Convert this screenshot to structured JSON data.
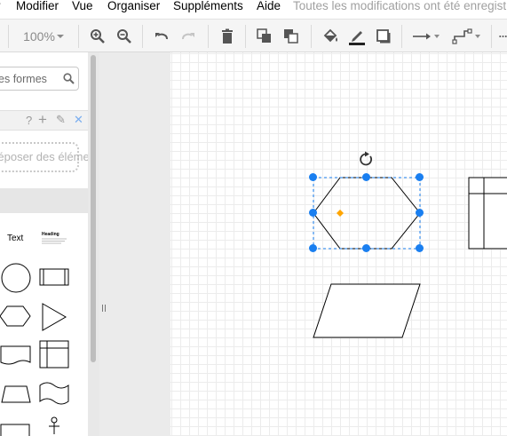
{
  "menu": {
    "items": [
      "Modifier",
      "Vue",
      "Organiser",
      "Suppléments",
      "Aide"
    ],
    "status": "Toutes les modifications ont été enregistrées"
  },
  "toolbar": {
    "zoom": "100%",
    "icons": [
      "zoom-in-icon",
      "zoom-out-icon",
      "undo-icon",
      "redo-icon",
      "delete-icon",
      "to-front-icon",
      "to-back-icon",
      "fill-color-icon",
      "line-color-icon",
      "shadow-icon",
      "connection-icon",
      "waypoints-icon",
      "more-icon"
    ]
  },
  "sidebar": {
    "search_placeholder": "Rechercher des formes",
    "scratchpad_actions": [
      "?",
      "+",
      "✎",
      "✕"
    ],
    "scratchpad_drop": "Déposer des éléments ici",
    "shapes": {
      "text_label": "Text",
      "heading_label": "Heading"
    }
  },
  "colors": {
    "selection": "#1a7ff0",
    "handle_marker": "#ffa500",
    "toolbar_bg": "#f5f5f5",
    "grid": "#ececec"
  }
}
